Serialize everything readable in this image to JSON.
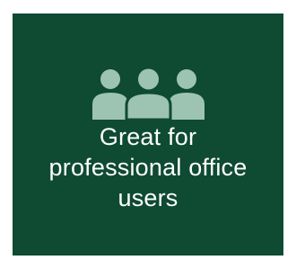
{
  "tile": {
    "background": "#0f4a33",
    "icon": "users-group-icon",
    "icon_color": "#9dc4b2",
    "text_color": "#ffffff",
    "caption_lines": [
      "Great for",
      "professional office",
      "users"
    ]
  }
}
